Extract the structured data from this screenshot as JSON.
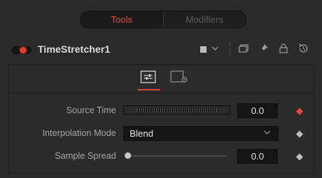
{
  "tabs": {
    "tools": "Tools",
    "modifiers": "Modifiers"
  },
  "tool": {
    "name": "TimeStretcher1"
  },
  "params": {
    "source_time": {
      "label": "Source Time",
      "value": "0.0",
      "keyframe_color": "#e0463c"
    },
    "interpolation_mode": {
      "label": "Interpolation Mode",
      "value": "Blend",
      "keyframe_color": "#bdbdbd"
    },
    "sample_spread": {
      "label": "Sample Spread",
      "value": "0.0",
      "slider_fraction": 0,
      "keyframe_color": "#bdbdbd"
    }
  },
  "colors": {
    "accent": "#e04a46",
    "enabled": "#e33b30"
  },
  "icons": [
    "toggle-switch-icon",
    "color-swatch-icon",
    "chevron-down-icon",
    "versions-icon",
    "pin-icon",
    "lock-icon",
    "reset-icon",
    "controls-tab-icon",
    "settings-tab-icon",
    "keyframe-icon"
  ]
}
